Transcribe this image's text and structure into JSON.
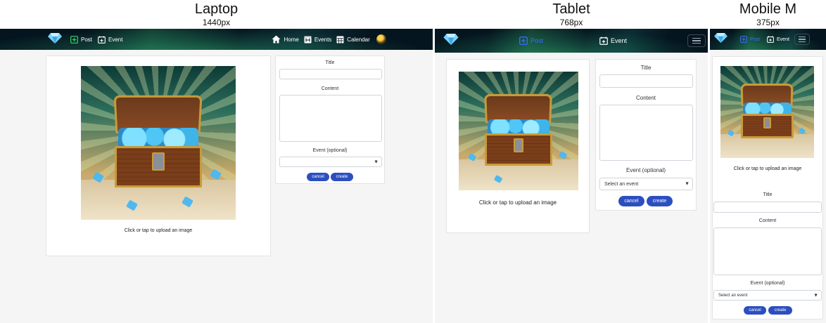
{
  "frames": {
    "laptop": {
      "title": "Laptop",
      "width_label": "1440px"
    },
    "tablet": {
      "title": "Tablet",
      "width_label": "768px"
    },
    "mobile": {
      "title": "Mobile M",
      "width_label": "375px"
    }
  },
  "nav": {
    "post_label": "Post",
    "event_label": "Event",
    "home_label": "Home",
    "events_label": "Events",
    "calendar_label": "Calendar"
  },
  "upload": {
    "prompt": "Click or tap to upload an image"
  },
  "form": {
    "title_label": "Title",
    "title_value": "",
    "content_label": "Content",
    "content_value": "",
    "event_label": "Event (optional)",
    "event_selected": "Select an event",
    "cancel_label": "cancel",
    "create_label": "create"
  },
  "colors": {
    "accent": "#2c4fc0",
    "active_nav": "#3b6cff",
    "nav_dark": "#05151f",
    "background": "#f5f5f5"
  },
  "icons": [
    "gem-logo-icon",
    "plus-square-icon",
    "calendar-plus-icon",
    "home-icon",
    "events-icon",
    "calendar-icon",
    "hamburger-icon",
    "chevron-down-icon"
  ]
}
